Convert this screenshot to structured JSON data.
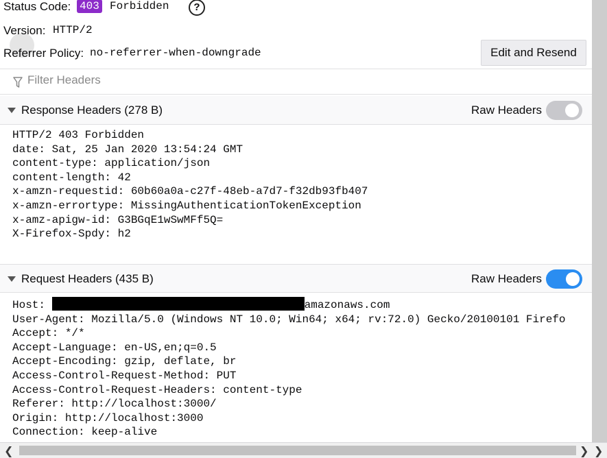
{
  "status": {
    "label": "Status Code:",
    "code": "403",
    "text": "Forbidden",
    "help_glyph": "?"
  },
  "version": {
    "label": "Version:",
    "value": "HTTP/2"
  },
  "referrer_policy": {
    "label": "Referrer Policy:",
    "value": "no-referrer-when-downgrade"
  },
  "edit_resend_label": "Edit and Resend",
  "filter": {
    "placeholder": "Filter Headers"
  },
  "response_section": {
    "title": "Response Headers (278 B)",
    "raw_label": "Raw Headers",
    "raw_enabled": false,
    "lines": [
      "HTTP/2 403 Forbidden",
      "date: Sat, 25 Jan 2020 13:54:24 GMT",
      "content-type: application/json",
      "content-length: 42",
      "x-amzn-requestid: 60b60a0a-c27f-48eb-a7d7-f32db93fb407",
      "x-amzn-errortype: MissingAuthenticationTokenException",
      "x-amz-apigw-id: G3BGqE1wSwMFf5Q=",
      "X-Firefox-Spdy: h2"
    ]
  },
  "request_section": {
    "title": "Request Headers (435 B)",
    "raw_label": "Raw Headers",
    "raw_enabled": true,
    "host_label": "Host: ",
    "host_suffix": "amazonaws.com",
    "lines": [
      "User-Agent: Mozilla/5.0 (Windows NT 10.0; Win64; x64; rv:72.0) Gecko/20100101 Firefo",
      "Accept: */*",
      "Accept-Language: en-US,en;q=0.5",
      "Accept-Encoding: gzip, deflate, br",
      "Access-Control-Request-Method: PUT",
      "Access-Control-Request-Headers: content-type",
      "Referer: http://localhost:3000/",
      "Origin: http://localhost:3000",
      "Connection: keep-alive"
    ]
  },
  "colors": {
    "status_badge": "#8c2bc9",
    "toggle_on": "#2a8df1",
    "toggle_off": "#c8c8cc"
  },
  "icons": {
    "help": "help-circle-icon",
    "filter": "filter-funnel-icon",
    "collapse": "triangle-down-icon",
    "scroll_left": "chevron-left-icon",
    "scroll_right": "chevron-right-icon"
  }
}
